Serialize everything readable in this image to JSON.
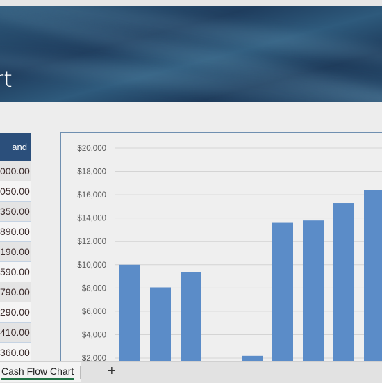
{
  "banner": {
    "title_fragment": "rt"
  },
  "table": {
    "header": "and",
    "rows": [
      "000.00",
      "050.00",
      "350.00",
      "890.00",
      "190.00",
      "590.00",
      "790.00",
      "290.00",
      "410.00",
      "360.00"
    ]
  },
  "chart_data": {
    "type": "bar",
    "y_tick_labels": [
      "$20,000",
      "$18,000",
      "$16,000",
      "$14,000",
      "$12,000",
      "$10,000",
      "$8,000",
      "$6,000",
      "$4,000",
      "$2,000"
    ],
    "ylim": [
      2000,
      20000
    ],
    "grid": true,
    "values": [
      10000,
      8050,
      9350,
      890,
      2190,
      13590,
      13790,
      15290,
      16410
    ],
    "bar_color": "#5b8cc8"
  },
  "sheet_tabs": {
    "active": "Cash Flow Chart",
    "add_label": "+"
  }
}
